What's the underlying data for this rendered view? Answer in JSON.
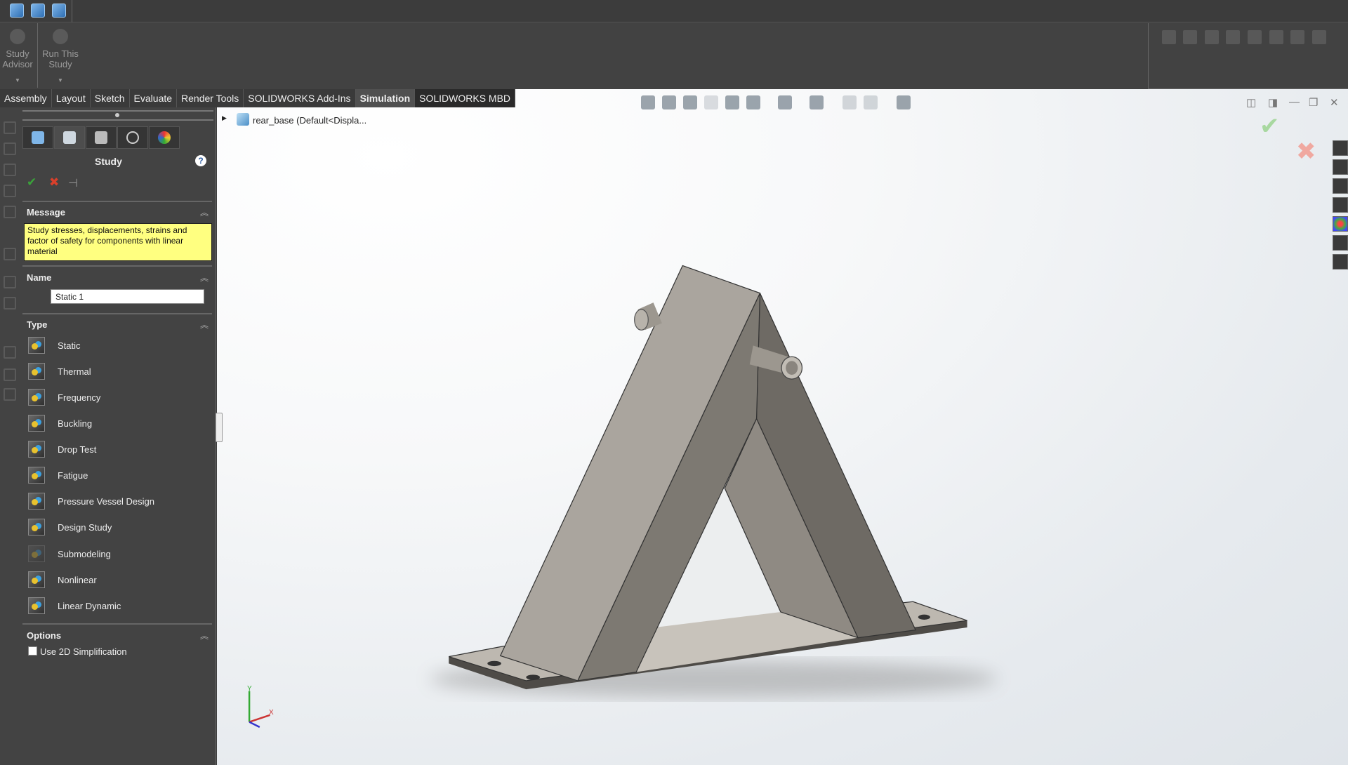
{
  "ribbon": {
    "study_advisor": "Study Advisor",
    "run_this_study": "Run This Study"
  },
  "tabs": [
    {
      "label": "Assembly"
    },
    {
      "label": "Layout"
    },
    {
      "label": "Sketch"
    },
    {
      "label": "Evaluate"
    },
    {
      "label": "Render Tools"
    },
    {
      "label": "SOLIDWORKS Add-Ins"
    },
    {
      "label": "Simulation",
      "active": true
    },
    {
      "label": "SOLIDWORKS MBD"
    }
  ],
  "tree": {
    "item": "rear_base  (Default<Displa..."
  },
  "panel": {
    "title": "Study",
    "message_header": "Message",
    "message": "Study stresses, displacements, strains and factor of safety  for components with linear material",
    "name_header": "Name",
    "name_value": "Static 1",
    "type_header": "Type",
    "types": [
      "Static",
      "Thermal",
      "Frequency",
      "Buckling",
      "Drop Test",
      "Fatigue",
      "Pressure Vessel Design",
      "Design Study",
      "Submodeling",
      "Nonlinear",
      "Linear Dynamic"
    ],
    "options_header": "Options",
    "option_2d": "Use 2D Simplification",
    "option_2d_checked": false
  },
  "triad": {
    "y": "Y",
    "x": "X"
  },
  "colors": {
    "accept": "#3aa33a",
    "cancel": "#d9402b",
    "message_bg": "#ffff80",
    "panel_bg": "#434343"
  }
}
